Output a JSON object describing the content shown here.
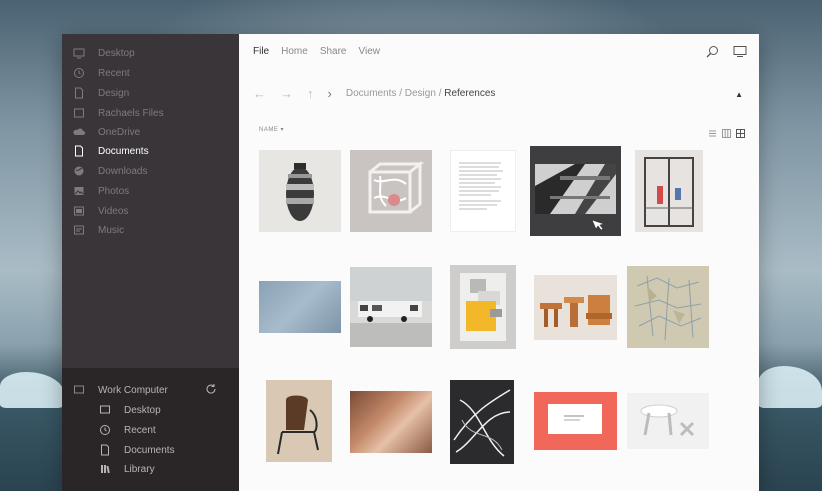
{
  "sidebar": {
    "items": [
      {
        "label": "Desktop",
        "icon": "monitor-icon"
      },
      {
        "label": "Recent",
        "icon": "clock-icon"
      },
      {
        "label": "Design",
        "icon": "document-icon"
      },
      {
        "label": "Rachaels Files",
        "icon": "folder-icon"
      },
      {
        "label": "OneDrive",
        "icon": "cloud-icon"
      },
      {
        "label": "Documents",
        "icon": "document-icon",
        "active": true
      },
      {
        "label": "Downloads",
        "icon": "globe-icon"
      },
      {
        "label": "Photos",
        "icon": "image-icon"
      },
      {
        "label": "Videos",
        "icon": "video-icon"
      },
      {
        "label": "Music",
        "icon": "music-icon"
      }
    ],
    "work": {
      "label": "Work Computer",
      "children": [
        {
          "label": "Desktop",
          "icon": "monitor-icon"
        },
        {
          "label": "Recent",
          "icon": "clock-icon"
        },
        {
          "label": "Documents",
          "icon": "document-icon"
        },
        {
          "label": "Library",
          "icon": "library-icon"
        }
      ]
    }
  },
  "toolbar": {
    "file": "File",
    "home": "Home",
    "share": "Share",
    "view": "View"
  },
  "path": {
    "part1": "Documents",
    "sep1": "/",
    "part2": "Design",
    "sep2": "/",
    "current": "References"
  },
  "sort": {
    "label": "NAME"
  },
  "thumbnails": [
    {
      "name": "vase"
    },
    {
      "name": "wire-cube"
    },
    {
      "name": "text-page"
    },
    {
      "name": "architecture"
    },
    {
      "name": "glass-door"
    },
    {
      "name": "blue-texture"
    },
    {
      "name": "trailer"
    },
    {
      "name": "yellow-poster"
    },
    {
      "name": "wood-furniture"
    },
    {
      "name": "geometric-map"
    },
    {
      "name": "bent-chair"
    },
    {
      "name": "canyon-rock"
    },
    {
      "name": "light-trails"
    },
    {
      "name": "red-card"
    },
    {
      "name": "white-table"
    }
  ]
}
